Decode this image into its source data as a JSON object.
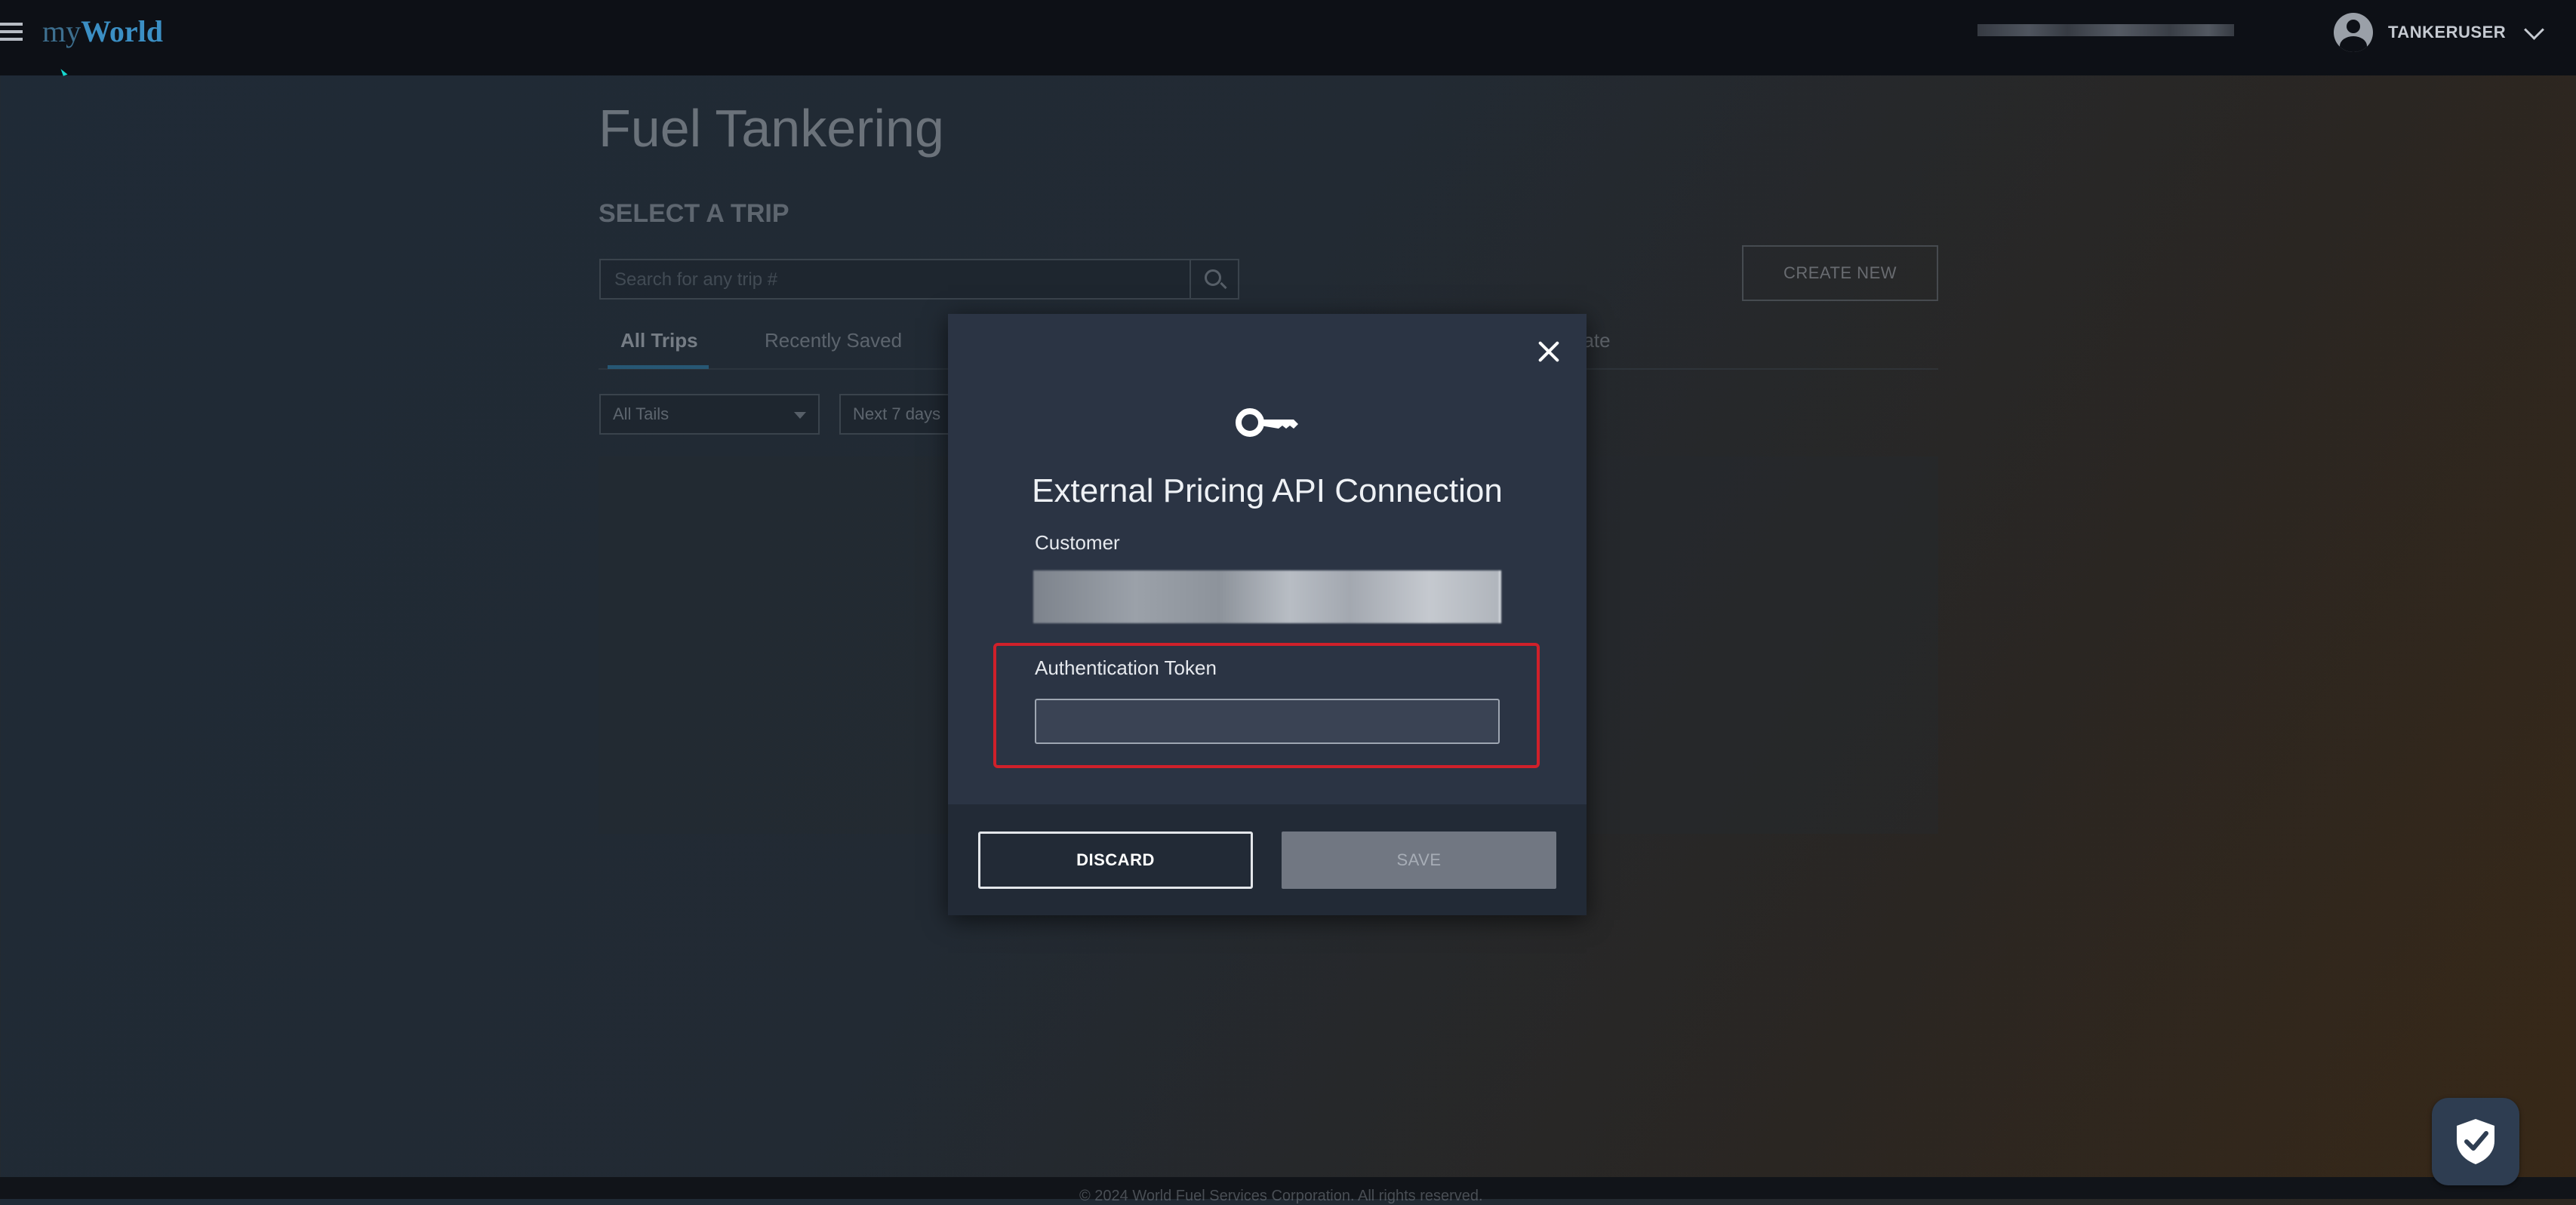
{
  "app": {
    "logo_my": "my",
    "logo_world": "World",
    "username": "TANKERUSER"
  },
  "page": {
    "title": "Fuel Tankering",
    "section_heading": "SELECT A TRIP",
    "search_placeholder": "Search for any trip #",
    "create_new_label": "CREATE NEW",
    "tabs": [
      {
        "label": "All Trips",
        "active": true
      },
      {
        "label": "Recently Saved",
        "active": false
      },
      {
        "label": "pate",
        "active": false
      }
    ],
    "filters": {
      "tails": "All Tails",
      "range": "Next 7 days"
    }
  },
  "modal": {
    "title": "External Pricing API Connection",
    "customer_label": "Customer",
    "token_label": "Authentication Token",
    "token_value": "",
    "discard_label": "DISCARD",
    "save_label": "SAVE"
  },
  "footer": {
    "text": "© 2024 World Fuel Services Corporation. All rights reserved."
  },
  "colors": {
    "accent": "#2f8fc5",
    "highlight": "#d0202a",
    "modal_bg": "#2b3444"
  },
  "icons": {
    "menu": "hamburger-icon",
    "search": "search-icon",
    "user": "user-avatar-icon",
    "close": "close-icon",
    "key": "key-icon",
    "shield": "shield-check-icon"
  }
}
